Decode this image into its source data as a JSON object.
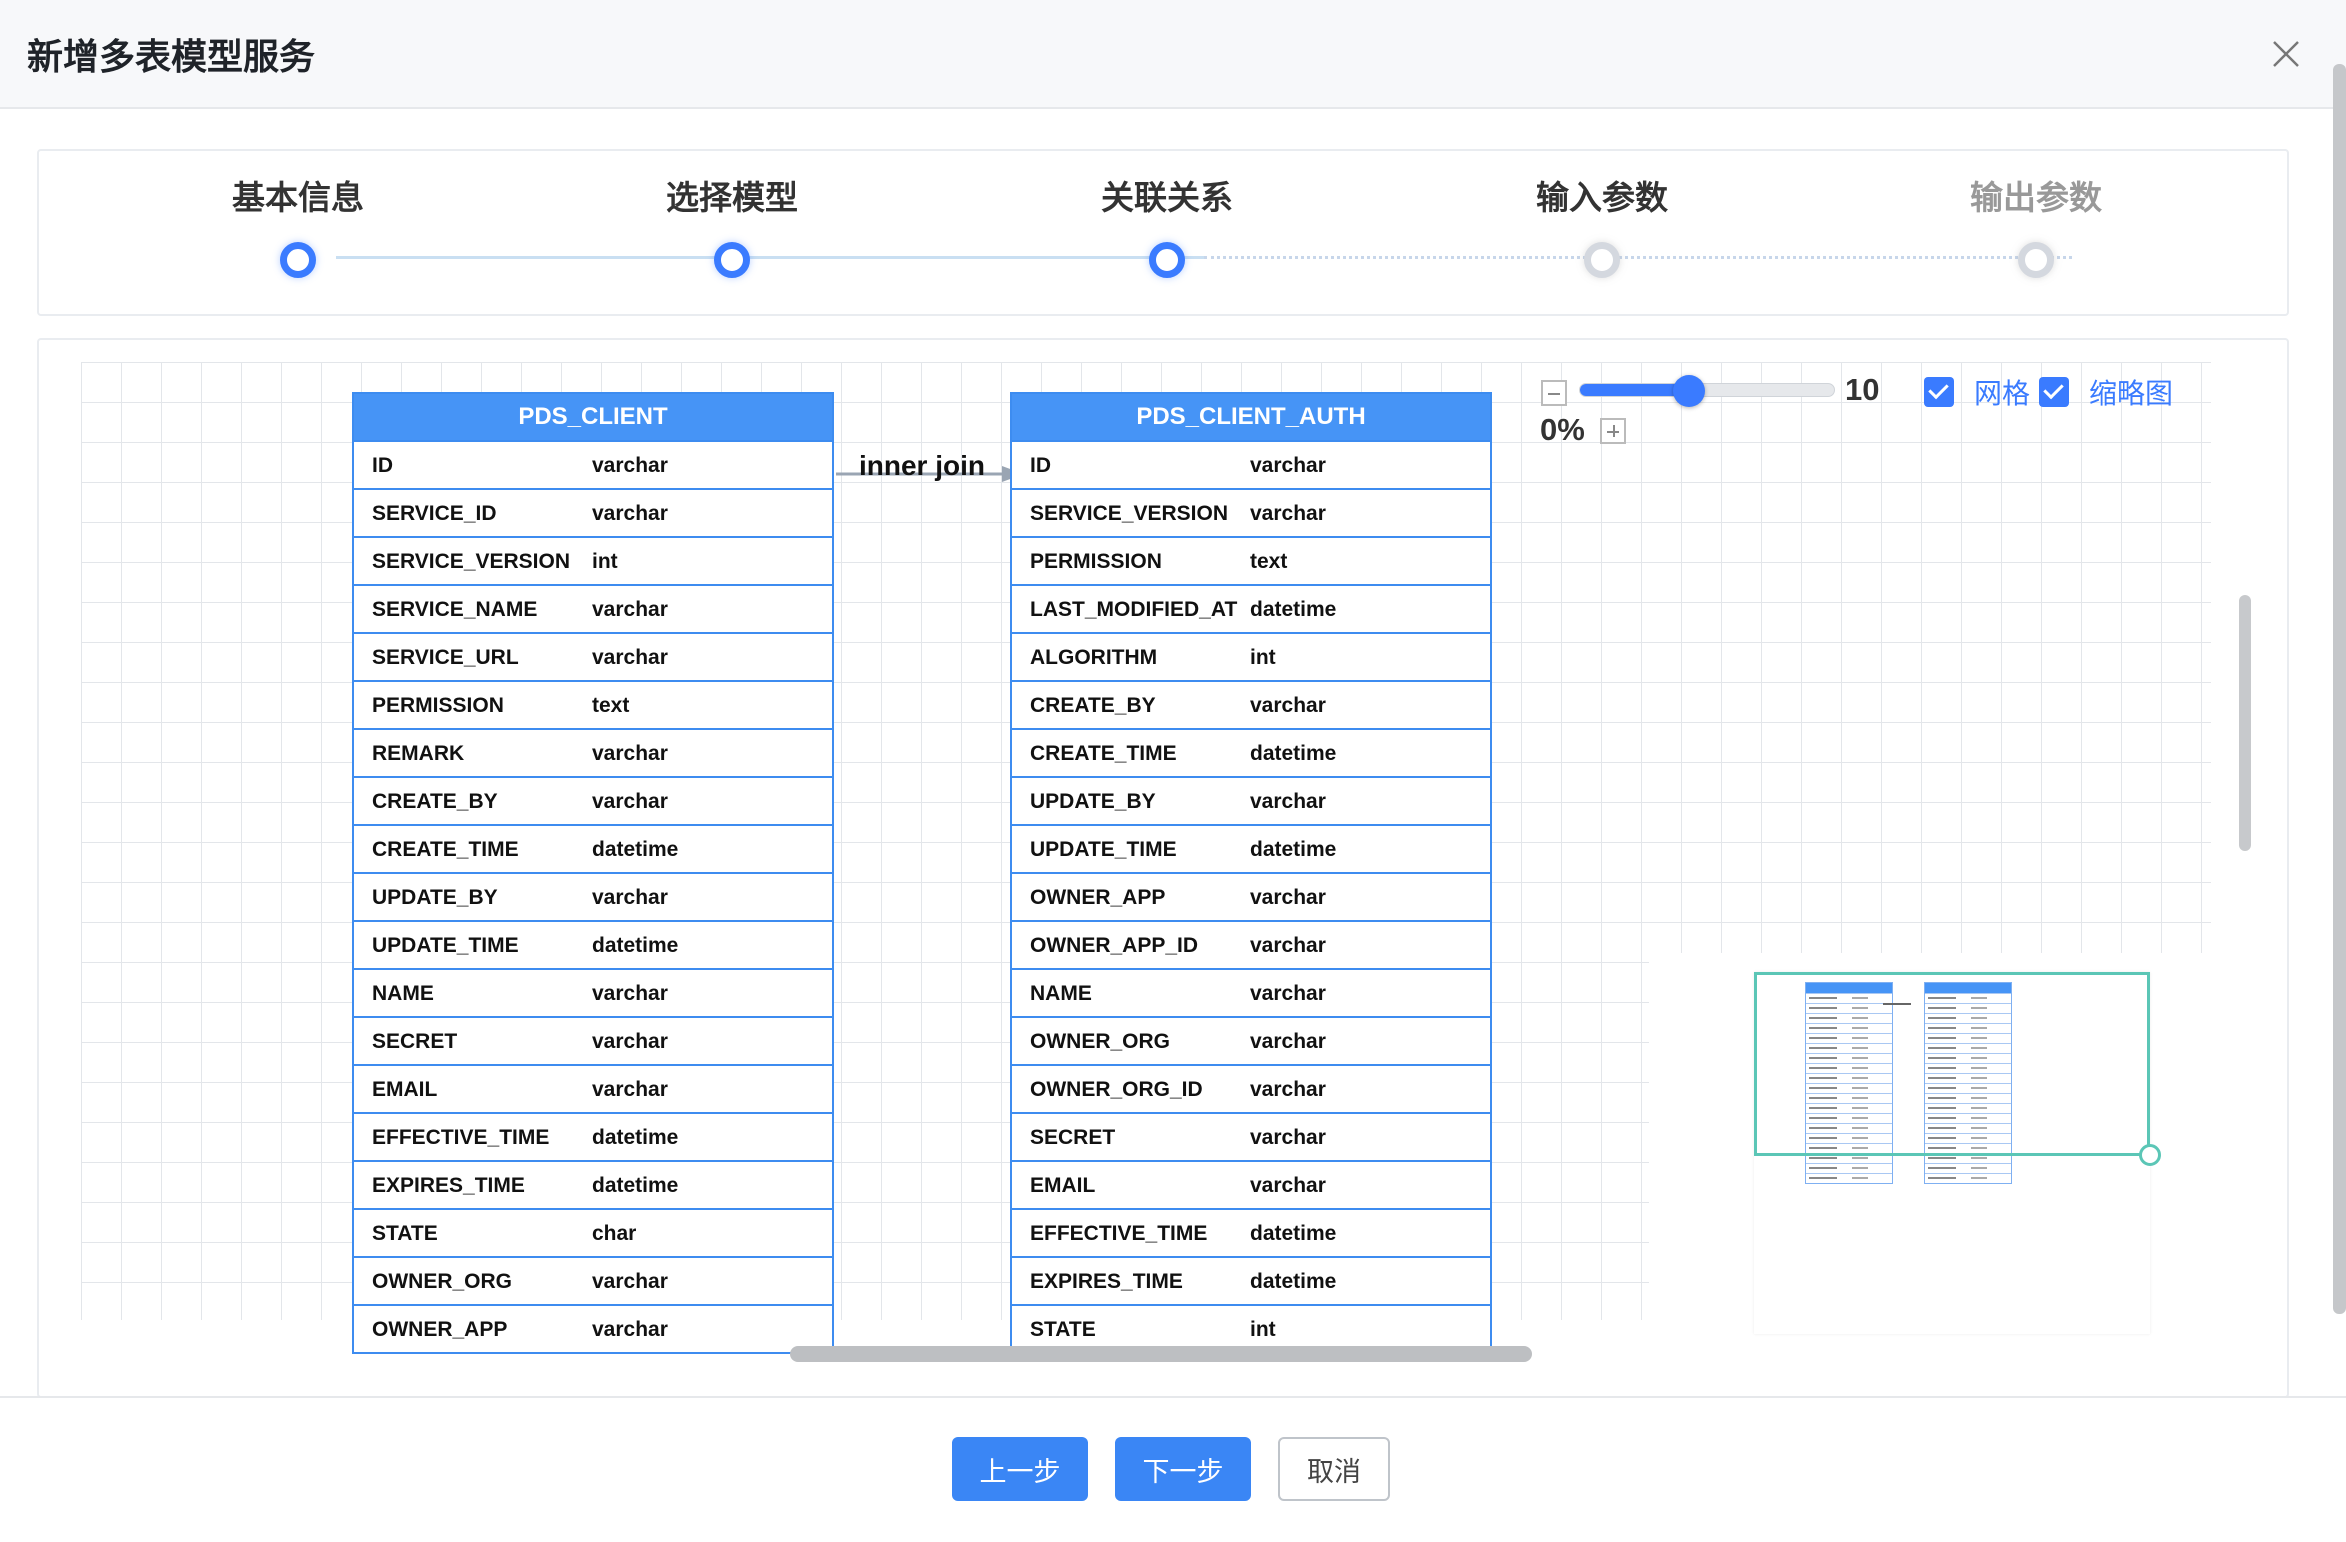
{
  "dialog": {
    "title": "新增多表模型服务"
  },
  "steps": [
    {
      "label": "基本信息",
      "status": "done"
    },
    {
      "label": "选择模型",
      "status": "done"
    },
    {
      "label": "关联关系",
      "status": "done"
    },
    {
      "label": "输入参数",
      "status": "todo"
    },
    {
      "label": "输出参数",
      "status": "todo"
    }
  ],
  "toolbar": {
    "slider_value": "10",
    "slider_fraction": 0.43,
    "zoom_percent": "0%",
    "grid_label": "网格",
    "grid_checked": true,
    "minimap_label": "缩略图",
    "minimap_checked": true
  },
  "join": {
    "label": "inner join"
  },
  "tables": [
    {
      "name": "PDS_CLIENT",
      "fields": [
        {
          "name": "ID",
          "type": "varchar"
        },
        {
          "name": "SERVICE_ID",
          "type": "varchar"
        },
        {
          "name": "SERVICE_VERSION",
          "type": "int"
        },
        {
          "name": "SERVICE_NAME",
          "type": "varchar"
        },
        {
          "name": "SERVICE_URL",
          "type": "varchar"
        },
        {
          "name": "PERMISSION",
          "type": "text"
        },
        {
          "name": "REMARK",
          "type": "varchar"
        },
        {
          "name": "CREATE_BY",
          "type": "varchar"
        },
        {
          "name": "CREATE_TIME",
          "type": "datetime"
        },
        {
          "name": "UPDATE_BY",
          "type": "varchar"
        },
        {
          "name": "UPDATE_TIME",
          "type": "datetime"
        },
        {
          "name": "NAME",
          "type": "varchar"
        },
        {
          "name": "SECRET",
          "type": "varchar"
        },
        {
          "name": "EMAIL",
          "type": "varchar"
        },
        {
          "name": "EFFECTIVE_TIME",
          "type": "datetime"
        },
        {
          "name": "EXPIRES_TIME",
          "type": "datetime"
        },
        {
          "name": "STATE",
          "type": "char"
        },
        {
          "name": "OWNER_ORG",
          "type": "varchar"
        },
        {
          "name": "OWNER_APP",
          "type": "varchar"
        }
      ]
    },
    {
      "name": "PDS_CLIENT_AUTH",
      "fields": [
        {
          "name": "ID",
          "type": "varchar"
        },
        {
          "name": "SERVICE_VERSION",
          "type": "varchar"
        },
        {
          "name": "PERMISSION",
          "type": "text"
        },
        {
          "name": "LAST_MODIFIED_AT",
          "type": "datetime"
        },
        {
          "name": "ALGORITHM",
          "type": "int"
        },
        {
          "name": "CREATE_BY",
          "type": "varchar"
        },
        {
          "name": "CREATE_TIME",
          "type": "datetime"
        },
        {
          "name": "UPDATE_BY",
          "type": "varchar"
        },
        {
          "name": "UPDATE_TIME",
          "type": "datetime"
        },
        {
          "name": "OWNER_APP",
          "type": "varchar"
        },
        {
          "name": "OWNER_APP_ID",
          "type": "varchar"
        },
        {
          "name": "NAME",
          "type": "varchar"
        },
        {
          "name": "OWNER_ORG",
          "type": "varchar"
        },
        {
          "name": "OWNER_ORG_ID",
          "type": "varchar"
        },
        {
          "name": "SECRET",
          "type": "varchar"
        },
        {
          "name": "EMAIL",
          "type": "varchar"
        },
        {
          "name": "EFFECTIVE_TIME",
          "type": "datetime"
        },
        {
          "name": "EXPIRES_TIME",
          "type": "datetime"
        },
        {
          "name": "STATE",
          "type": "int"
        }
      ]
    }
  ],
  "footer": {
    "prev_label": "上一步",
    "next_label": "下一步",
    "cancel_label": "取消"
  },
  "colors": {
    "primary": "#3a7bff",
    "table_header": "#4694f6",
    "table_border": "#3d8cf0",
    "minimap_viewport": "#5bc6b6"
  }
}
